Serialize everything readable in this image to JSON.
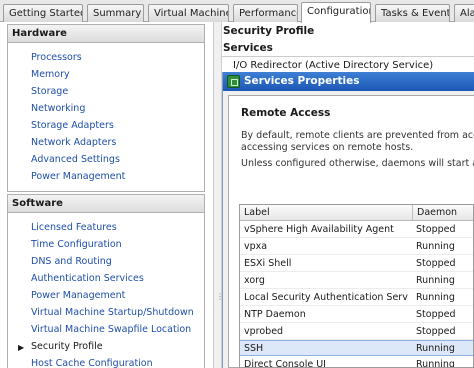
{
  "tabs": [
    {
      "label": "Getting Started"
    },
    {
      "label": "Summary"
    },
    {
      "label": "Virtual Machines"
    },
    {
      "label": "Performance"
    },
    {
      "label": "Configuration",
      "active": true
    },
    {
      "label": "Tasks & Events"
    },
    {
      "label": "Ala"
    }
  ],
  "hardware": {
    "title": "Hardware",
    "items": [
      "Processors",
      "Memory",
      "Storage",
      "Networking",
      "Storage Adapters",
      "Network Adapters",
      "Advanced Settings",
      "Power Management"
    ]
  },
  "software": {
    "title": "Software",
    "items": [
      "Licensed Features",
      "Time Configuration",
      "DNS and Routing",
      "Authentication Services",
      "Power Management",
      "Virtual Machine Startup/Shutdown",
      "Virtual Machine Swapfile Location",
      "Security Profile",
      "Host Cache Configuration"
    ],
    "selected": "Security Profile"
  },
  "right": {
    "title": "Security Profile",
    "subtitle": "Services",
    "first_item": "I/O Redirector (Active Directory Service)"
  },
  "dialog": {
    "title": "Services Properties",
    "heading": "Remote Access",
    "text1": "By default, remote clients are prevented from accessing",
    "text2": "accessing services on remote hosts.",
    "text3": "Unless configured otherwise, daemons will start autom"
  },
  "services_table": {
    "columns": [
      "Label",
      "Daemon"
    ],
    "rows": [
      {
        "label": "vSphere High Availability Agent",
        "daemon": "Stopped"
      },
      {
        "label": "vpxa",
        "daemon": "Running"
      },
      {
        "label": "ESXi Shell",
        "daemon": "Stopped"
      },
      {
        "label": "xorg",
        "daemon": "Running"
      },
      {
        "label": "Local Security Authentication Serv...",
        "daemon": "Running"
      },
      {
        "label": "NTP Daemon",
        "daemon": "Stopped"
      },
      {
        "label": "vprobed",
        "daemon": "Stopped"
      },
      {
        "label": "SSH",
        "daemon": "Running",
        "selected": true
      },
      {
        "label": "Direct Console UI",
        "daemon": "Running"
      }
    ]
  },
  "colors": {
    "link": "#1f4fa8",
    "titlebar": "#1b57b5",
    "selection": "#dce8f7"
  }
}
